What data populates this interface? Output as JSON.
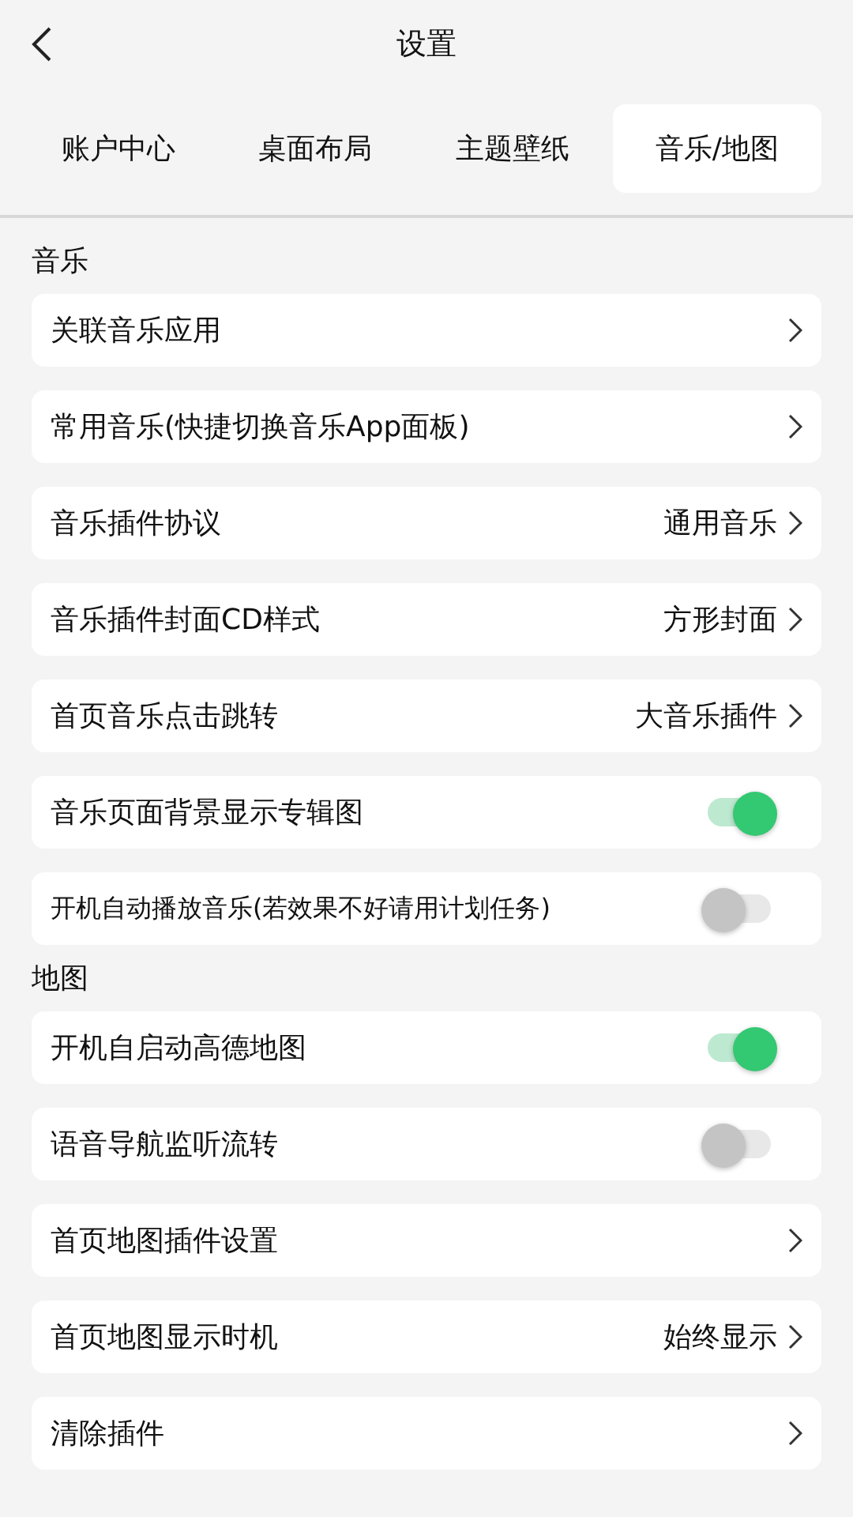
{
  "header": {
    "title": "设置"
  },
  "tabs": [
    {
      "label": "账户中心",
      "selected": false
    },
    {
      "label": "桌面布局",
      "selected": false
    },
    {
      "label": "主题壁纸",
      "selected": false
    },
    {
      "label": "音乐/地图",
      "selected": true
    }
  ],
  "sections": [
    {
      "title": "音乐",
      "rows": [
        {
          "kind": "link",
          "label": "关联音乐应用"
        },
        {
          "kind": "link",
          "label": "常用音乐(快捷切换音乐App面板)"
        },
        {
          "kind": "link",
          "label": "音乐插件协议",
          "value": "通用音乐"
        },
        {
          "kind": "link",
          "label": "音乐插件封面CD样式",
          "value": "方形封面"
        },
        {
          "kind": "link",
          "label": "首页音乐点击跳转",
          "value": "大音乐插件"
        },
        {
          "kind": "toggle",
          "label": "音乐页面背景显示专辑图",
          "on": true
        },
        {
          "kind": "toggle",
          "label": "开机自动播放音乐(若效果不好请用计划任务)",
          "on": false
        }
      ]
    },
    {
      "title": "地图",
      "rows": [
        {
          "kind": "toggle",
          "label": "开机自启动高德地图",
          "on": true
        },
        {
          "kind": "toggle",
          "label": "语音导航监听流转",
          "on": false
        },
        {
          "kind": "link",
          "label": "首页地图插件设置"
        },
        {
          "kind": "link",
          "label": "首页地图显示时机",
          "value": "始终显示"
        },
        {
          "kind": "link",
          "label": "清除插件"
        }
      ]
    }
  ]
}
